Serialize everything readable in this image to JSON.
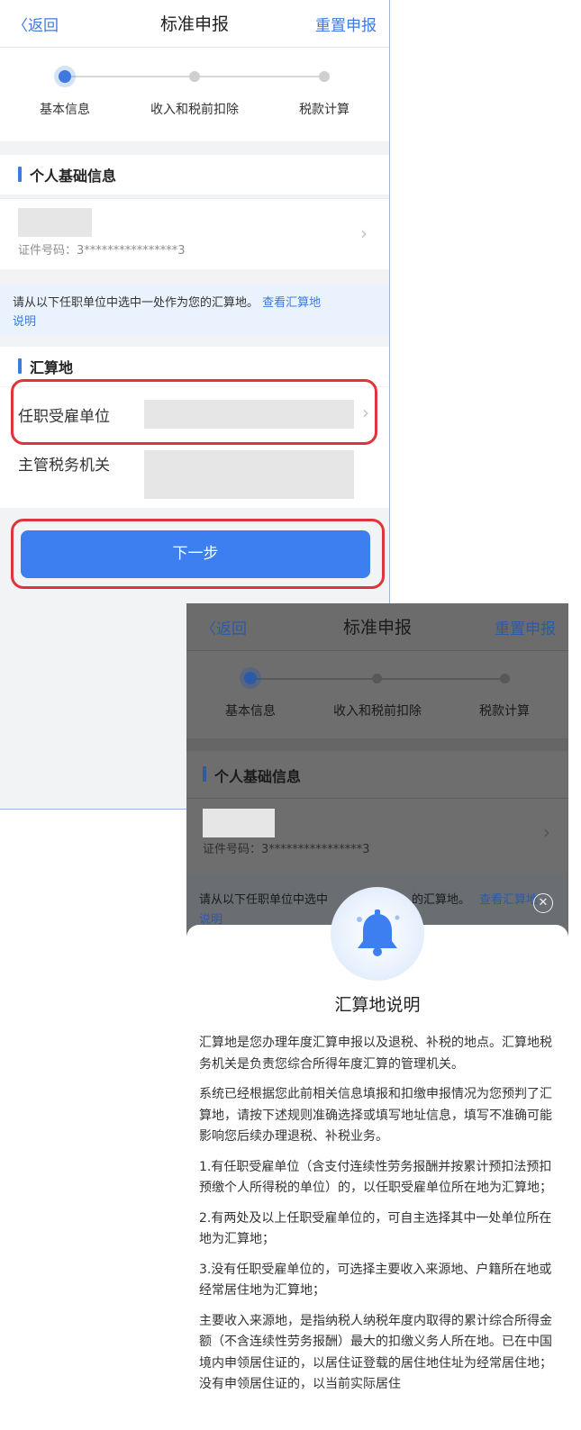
{
  "screen1": {
    "nav": {
      "back_label": "返回",
      "title": "标准申报",
      "reset_label": "重置申报"
    },
    "steps": [
      {
        "label": "基本信息",
        "active": true
      },
      {
        "label": "收入和税前扣除",
        "active": false
      },
      {
        "label": "税款计算",
        "active": false
      }
    ],
    "personal": {
      "section_title": "个人基础信息",
      "id_label": "证件号码：",
      "id_value": "3****************3"
    },
    "tip": {
      "text": "请从以下任职单位中选中一处作为您的汇算地。",
      "link": "查看汇算地",
      "link2": "说明"
    },
    "settlement": {
      "section_title": "汇算地",
      "employer_label": "任职受雇单位",
      "tax_authority_label": "主管税务机关"
    },
    "next_button": "下一步"
  },
  "screen2": {
    "nav": {
      "back_label": "返回",
      "title": "标准申报",
      "reset_label": "重置申报"
    },
    "steps": [
      {
        "label": "基本信息",
        "active": true
      },
      {
        "label": "收入和税前扣除",
        "active": false
      },
      {
        "label": "税款计算",
        "active": false
      }
    ],
    "personal": {
      "section_title": "个人基础信息",
      "id_label": "证件号码：",
      "id_value": "3****************3"
    },
    "tip": {
      "text_left": "请从以下任职单位中选中",
      "text_right": "的汇算地。",
      "link": "查看汇算地",
      "link2": "说明"
    },
    "modal": {
      "title": "汇算地说明",
      "paragraphs": [
        "汇算地是您办理年度汇算申报以及退税、补税的地点。汇算地税务机关是负责您综合所得年度汇算的管理机关。",
        "系统已经根据您此前相关信息填报和扣缴申报情况为您预判了汇算地，请按下述规则准确选择或填写地址信息，填写不准确可能影响您后续办理退税、补税业务。",
        "1.有任职受雇单位（含支付连续性劳务报酬并按累计预扣法预扣预缴个人所得税的单位）的，以任职受雇单位所在地为汇算地；",
        "2.有两处及以上任职受雇单位的，可自主选择其中一处单位所在地为汇算地；",
        "3.没有任职受雇单位的，可选择主要收入来源地、户籍所在地或经常居住地为汇算地；",
        "主要收入来源地，是指纳税人纳税年度内取得的累计综合所得金额（不含连续性劳务报酬）最大的扣缴义务人所在地。已在中国境内申领居住证的，以居住证登载的居住地住址为经常居住地；没有申领居住证的，以当前实际居住"
      ]
    }
  },
  "colors": {
    "accent": "#3d79e0",
    "highlight_red": "#e0333a",
    "button_blue": "#3d7ff0"
  }
}
